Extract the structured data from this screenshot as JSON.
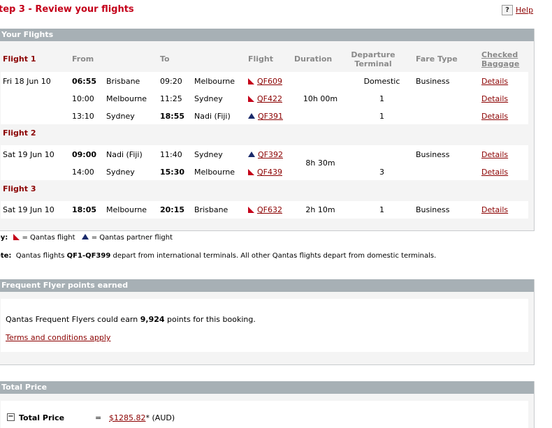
{
  "page": {
    "step_title": "tep 3 - Review your flights",
    "help_icon": "?",
    "help_label": "Help"
  },
  "flights": {
    "header": "Your Flights",
    "columns": {
      "from": "From",
      "to": "To",
      "flight": "Flight",
      "duration": "Duration",
      "departure_terminal_1": "Departure",
      "departure_terminal_2": "Terminal",
      "fare_type": "Fare Type",
      "checked_baggage_1": "Checked",
      "checked_baggage_2": "Baggage"
    },
    "groups": [
      {
        "label": "Flight 1",
        "duration": "10h 00m",
        "fare_type": "Business",
        "legs": [
          {
            "date": "Fri 18 Jun 10",
            "dep_time": "06:55",
            "from": "Brisbane",
            "arr_time": "09:20",
            "to": "Melbourne",
            "carrier": "qantas",
            "flight_no": "QF609",
            "terminal": "Domestic",
            "details": "Details"
          },
          {
            "date": "",
            "dep_time": "10:00",
            "from": "Melbourne",
            "arr_time": "11:25",
            "to": "Sydney",
            "carrier": "qantas",
            "flight_no": "QF422",
            "terminal": "1",
            "details": "Details"
          },
          {
            "date": "",
            "dep_time": "13:10",
            "from": "Sydney",
            "arr_time": "18:55",
            "to": "Nadi (Fiji)",
            "carrier": "partner",
            "flight_no": "QF391",
            "terminal": "1",
            "details": "Details"
          }
        ]
      },
      {
        "label": "Flight 2",
        "duration": "8h 30m",
        "fare_type": "Business",
        "legs": [
          {
            "date": "Sat 19 Jun 10",
            "dep_time": "09:00",
            "from": "Nadi (Fiji)",
            "arr_time": "11:40",
            "to": "Sydney",
            "carrier": "partner",
            "flight_no": "QF392",
            "terminal": "",
            "details": "Details"
          },
          {
            "date": "",
            "dep_time": "14:00",
            "from": "Sydney",
            "arr_time": "15:30",
            "to": "Melbourne",
            "carrier": "qantas",
            "flight_no": "QF439",
            "terminal": "3",
            "details": "Details"
          }
        ]
      },
      {
        "label": "Flight 3",
        "duration": "2h 10m",
        "fare_type": "Business",
        "legs": [
          {
            "date": "Sat 19 Jun 10",
            "dep_time": "18:05",
            "from": "Melbourne",
            "arr_time": "20:15",
            "to": "Brisbane",
            "carrier": "qantas",
            "flight_no": "QF632",
            "terminal": "1",
            "details": "Details"
          }
        ]
      }
    ]
  },
  "key": {
    "prefix": "ey:",
    "qantas_label": "= Qantas flight",
    "partner_label": "= Qantas partner flight"
  },
  "note": {
    "prefix": "ote:",
    "text_before": "Qantas flights",
    "range": "QF1-QF399",
    "text_after": "depart from international terminals. All other Qantas flights depart from domestic terminals."
  },
  "frequent_flyer": {
    "header": "Frequent Flyer points earned",
    "text_before": "Qantas Frequent Flyers could earn",
    "points": "9,924",
    "text_after": "points for this booking.",
    "terms_link": "Terms and conditions apply"
  },
  "total": {
    "header": "Total Price",
    "label": "Total Price",
    "equals": "=",
    "amount": "$1285.82",
    "suffix": "* (AUD)",
    "collapse_icon": "−"
  },
  "colors": {
    "accent_red": "#c4001a",
    "link_red": "#8b0000",
    "header_gray": "#a7b0b5",
    "partner_blue": "#1a2a6b"
  }
}
